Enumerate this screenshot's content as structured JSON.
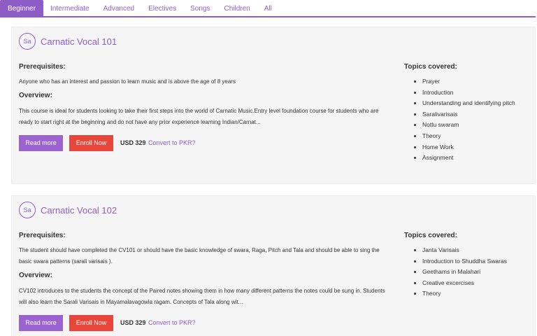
{
  "tabs": [
    "Beginner",
    "Intermediate",
    "Advanced",
    "Electives",
    "Songs",
    "Children",
    "All"
  ],
  "active_tab": "Beginner",
  "courses": [
    {
      "badge": "Sa",
      "title": "Carnatic Vocal 101",
      "prereq_heading": "Prerequisites:",
      "prereq_text": "Anyone who has an interest and passion to learn music and is above the age of 8 years",
      "overview_heading": "Overview:",
      "overview_text": "This course is ideal for students looking to take their first steps into the world of Carnatic Music.Entry level foundation course for students who are ready to start right at the beginning and do not have any prior experience learning Indian/Carnat...",
      "read_more": "Read more",
      "enroll": "Enroll Now",
      "price": "USD 329",
      "convert": "Convert to PKR?",
      "topics_heading": "Topics covered:",
      "topics": [
        "Prayer",
        "Introduction",
        "Understanding and identifying pitch",
        "Saralivarisais",
        "Nottu swaram",
        "Theory",
        "Home Work",
        "Assignment"
      ]
    },
    {
      "badge": "Sa",
      "title": "Carnatic Vocal 102",
      "prereq_heading": "Prerequisites:",
      "prereq_text": "The student should have completed the CV101 or should have the basic knowledge of swara, Raga, Pitch and Tala and should be able to sing the basic swara patterns (sarali varisais ).",
      "overview_heading": "Overview:",
      "overview_text": "CV102 introduces to the students the concept of the Paired notes showing them in how many different patterns the notes could be sung in. Students will also learn the Sarali Varisais in Mayamalavagowla ragam. Concepts of Tala along wit...",
      "read_more": "Read more",
      "enroll": "Enroll Now",
      "price": "USD 329",
      "convert": "Convert to PKR?",
      "topics_heading": "Topics covered:",
      "topics": [
        "Janta Varisais",
        "Introduction to Shuddha Swaras",
        "Geethams in Malahari",
        "Creative excercises",
        "Theory"
      ]
    }
  ]
}
